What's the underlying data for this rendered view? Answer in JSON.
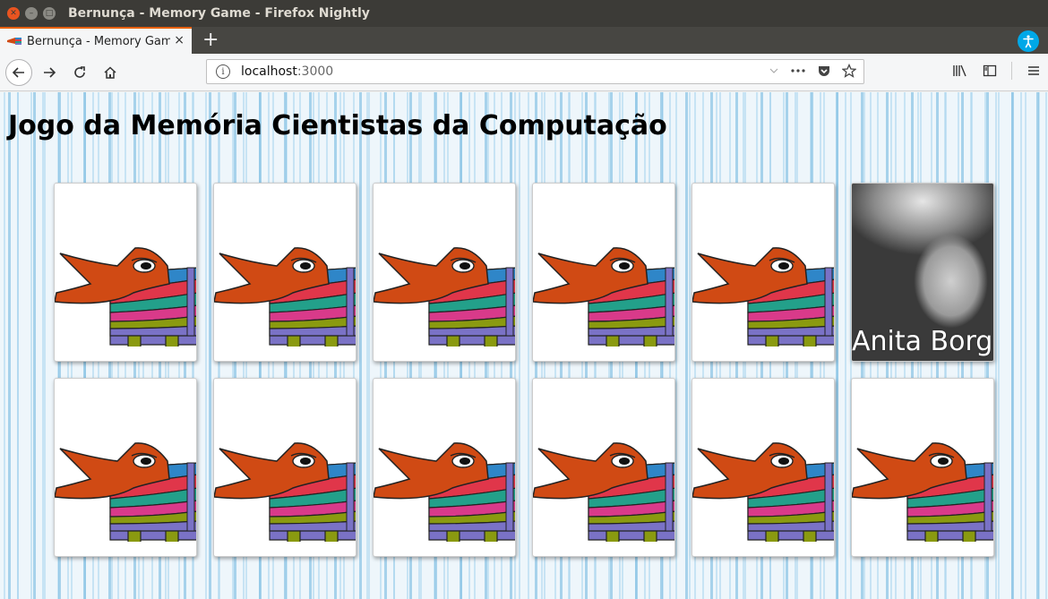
{
  "window": {
    "title": "Bernunça - Memory Game - Firefox Nightly"
  },
  "tab": {
    "label": "Bernunça - Memory Game",
    "close_glyph": "×",
    "new_tab_glyph": "+"
  },
  "urlbar": {
    "host": "localhost",
    "port": ":3000"
  },
  "page": {
    "heading": "Jogo da Memória Cientistas da Computação"
  },
  "cards": [
    {
      "state": "hidden"
    },
    {
      "state": "hidden"
    },
    {
      "state": "hidden"
    },
    {
      "state": "hidden"
    },
    {
      "state": "hidden"
    },
    {
      "state": "revealed",
      "name": "Anita Borg"
    },
    {
      "state": "hidden"
    },
    {
      "state": "hidden"
    },
    {
      "state": "hidden"
    },
    {
      "state": "hidden"
    },
    {
      "state": "hidden"
    },
    {
      "state": "hidden"
    }
  ],
  "colors": {
    "tab_accent": "#e66000",
    "title_bar": "#3c3b37",
    "a11y": "#00a8e8",
    "bernunca_head": "#d04a14"
  }
}
